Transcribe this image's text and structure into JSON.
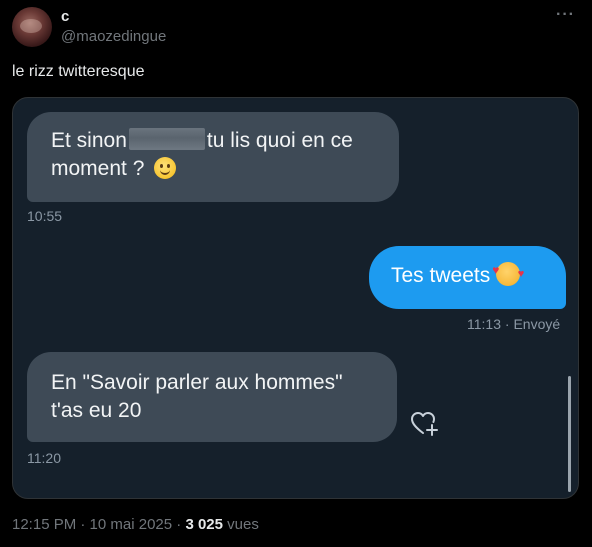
{
  "author": {
    "display_name": "c",
    "handle": "@maozedingue"
  },
  "more_icon": "more-horizontal-icon",
  "tweet": {
    "text": "le rizz twitteresque"
  },
  "conversation": {
    "msg1": {
      "before_redaction": "Et sinon",
      "after_redaction": "tu lis quoi en ce moment ?",
      "emoji": "slightly-smiling-face",
      "time": "10:55"
    },
    "msg2": {
      "text": "Tes tweets",
      "emoji": "smiling-face-with-hearts",
      "time": "11:13",
      "status": "· Envoyé",
      "color": "#1d9bf0"
    },
    "msg3": {
      "line1": "En \"Savoir parler aux hommes\"",
      "line2": "t'as eu 20",
      "time": "11:20"
    },
    "react_icon": "heart-add-icon"
  },
  "footer": {
    "timestamp": "12:15 PM · 10 mai 2025 · ",
    "views_count": "3 025",
    "views_label": " vues"
  },
  "colors": {
    "background": "#000000",
    "dm_background": "#15202b",
    "incoming_bubble": "#3e4a56",
    "outgoing_bubble": "#1d9bf0"
  }
}
